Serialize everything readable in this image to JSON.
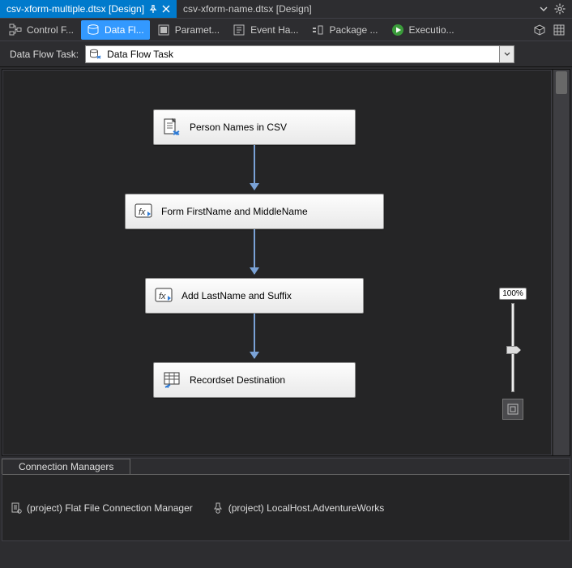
{
  "doc_tabs": {
    "active": "csv-xform-multiple.dtsx [Design]",
    "inactive": "csv-xform-name.dtsx [Design]"
  },
  "designer_tabs": {
    "t0": "Control F...",
    "t1": "Data Fl...",
    "t2": "Paramet...",
    "t3": "Event Ha...",
    "t4": "Package ...",
    "t5": "Executio..."
  },
  "dft": {
    "label": "Data Flow Task:",
    "value": "Data Flow Task"
  },
  "nodes": {
    "n0": "Person Names in CSV",
    "n1": "Form FirstName and MiddleName",
    "n2": "Add LastName and Suffix",
    "n3": "Recordset Destination"
  },
  "zoom": {
    "label": "100%"
  },
  "cm": {
    "title": "Connection Managers",
    "c0": "(project) Flat File Connection Manager",
    "c1": "(project) LocalHost.AdventureWorks"
  }
}
